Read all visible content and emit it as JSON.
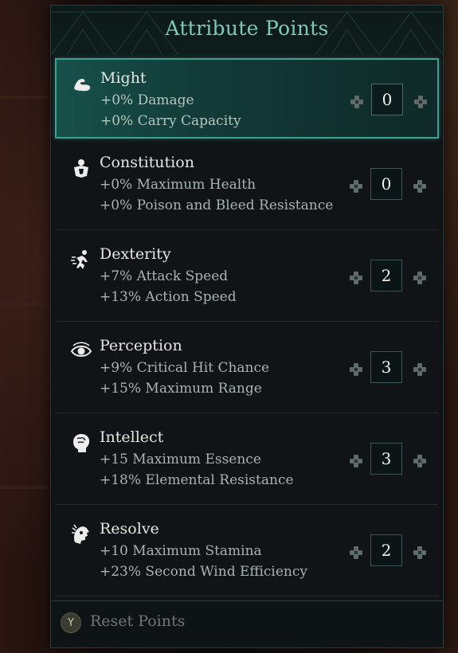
{
  "panel": {
    "title": "Attribute Points"
  },
  "attributes": [
    {
      "name": "Might",
      "icon": "muscle-arm-icon",
      "effect1": "+0% Damage",
      "effect2": "+0% Carry Capacity",
      "value": "0",
      "selected": true
    },
    {
      "name": "Constitution",
      "icon": "body-shield-icon",
      "effect1": "+0% Maximum Health",
      "effect2": "+0% Poison and Bleed Resistance",
      "value": "0",
      "selected": false
    },
    {
      "name": "Dexterity",
      "icon": "running-figure-icon",
      "effect1": "+7% Attack Speed",
      "effect2": "+13% Action Speed",
      "value": "2",
      "selected": false
    },
    {
      "name": "Perception",
      "icon": "eye-icon",
      "effect1": "+9% Critical Hit Chance",
      "effect2": "+15% Maximum Range",
      "value": "3",
      "selected": false
    },
    {
      "name": "Intellect",
      "icon": "brain-head-icon",
      "effect1": "+15 Maximum Essence",
      "effect2": "+18% Elemental Resistance",
      "value": "3",
      "selected": false
    },
    {
      "name": "Resolve",
      "icon": "resolve-head-icon",
      "effect1": "+10 Maximum Stamina",
      "effect2": "+23% Second Wind Efficiency",
      "value": "2",
      "selected": false
    }
  ],
  "footer": {
    "button_glyph": "Y",
    "reset_label": "Reset Points"
  },
  "colors": {
    "accent": "#39a391",
    "title": "#7ec9b9"
  }
}
